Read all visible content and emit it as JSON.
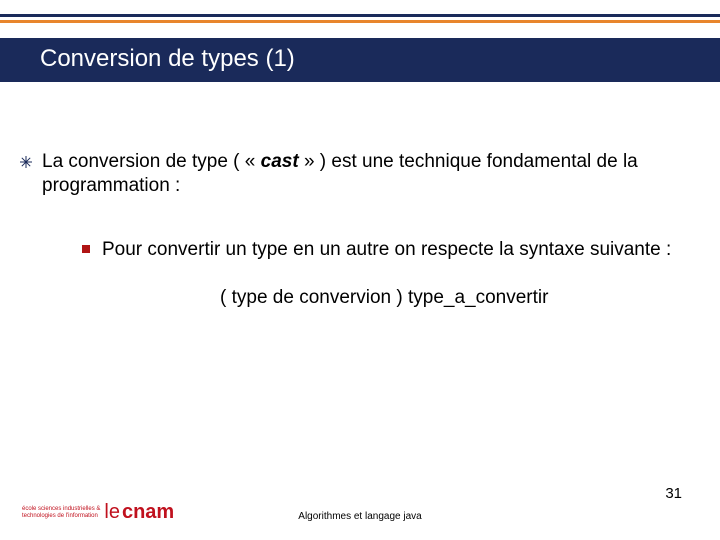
{
  "title": "Conversion de types (1)",
  "bullet1_pre": "La conversion de type ( « ",
  "bullet1_bold": "cast",
  "bullet1_post": " » ) est une technique fondamental de la programmation :",
  "sub1": "Pour convertir un type en un autre on respecte la syntaxe suivante :",
  "syntax_line": "( type de convervion ) type_a_convertir",
  "footer": "Algorithmes et langage java",
  "page": "31",
  "logo_line1": "école sciences industrielles &",
  "logo_line2": "technologies de l'information",
  "logo_le": "le",
  "logo_cnam": "cnam"
}
